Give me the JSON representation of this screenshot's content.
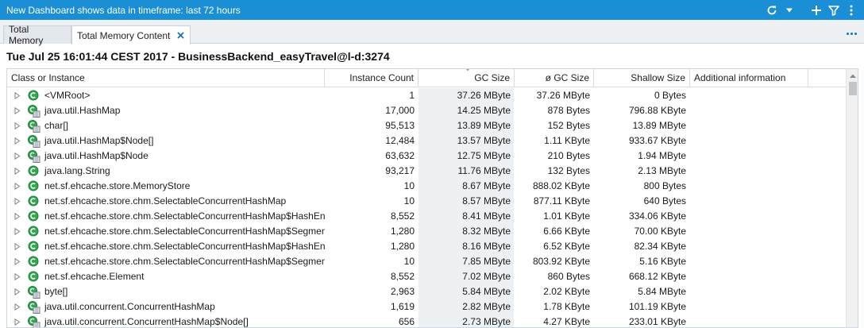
{
  "topbar": {
    "title": "New Dashboard shows data in timeframe: last 72 hours",
    "icons": [
      "refresh-icon",
      "dropdown-icon",
      "add-icon",
      "filter-icon",
      "more-vertical-icon"
    ]
  },
  "tabs": [
    {
      "label": "Total Memory"
    },
    {
      "label": "Total Memory Content"
    }
  ],
  "heading": "Tue Jul 25 16:01:44 CEST 2017 - BusinessBackend_easyTravel@l-d:3274",
  "table": {
    "columns": [
      "Class or Instance",
      "Instance Count",
      "GC Size",
      "ø GC Size",
      "Shallow Size",
      "Additional information"
    ],
    "sorted_column": "GC Size",
    "rows": [
      {
        "name": "<VMRoot>",
        "count": "1",
        "gc": "37.26 MByte",
        "avg": "37.26 MByte",
        "shallow": "0 Bytes",
        "info": "",
        "icon": "class-icon"
      },
      {
        "name": "java.util.HashMap",
        "count": "17,000",
        "gc": "14.25 MByte",
        "avg": "878 Bytes",
        "shallow": "796.88 KByte",
        "info": "",
        "icon": "class-instances-icon"
      },
      {
        "name": "char[]",
        "count": "95,513",
        "gc": "13.89 MByte",
        "avg": "152 Bytes",
        "shallow": "13.89 MByte",
        "info": "",
        "icon": "class-instances-icon"
      },
      {
        "name": "java.util.HashMap$Node[]",
        "count": "12,484",
        "gc": "13.57 MByte",
        "avg": "1.11 KByte",
        "shallow": "933.67 KByte",
        "info": "",
        "icon": "class-instances-icon"
      },
      {
        "name": "java.util.HashMap$Node",
        "count": "63,632",
        "gc": "12.75 MByte",
        "avg": "210 Bytes",
        "shallow": "1.94 MByte",
        "info": "",
        "icon": "class-instances-icon"
      },
      {
        "name": "java.lang.String",
        "count": "93,217",
        "gc": "11.76 MByte",
        "avg": "132 Bytes",
        "shallow": "2.13 MByte",
        "info": "",
        "icon": "class-icon"
      },
      {
        "name": "net.sf.ehcache.store.MemoryStore",
        "count": "10",
        "gc": "8.67 MByte",
        "avg": "888.02 KByte",
        "shallow": "800 Bytes",
        "info": "",
        "icon": "class-icon"
      },
      {
        "name": "net.sf.ehcache.store.chm.SelectableConcurrentHashMap",
        "count": "10",
        "gc": "8.57 MByte",
        "avg": "877.11 KByte",
        "shallow": "640 Bytes",
        "info": "",
        "icon": "class-icon"
      },
      {
        "name": "net.sf.ehcache.store.chm.SelectableConcurrentHashMap$HashEntry",
        "count": "8,552",
        "gc": "8.41 MByte",
        "avg": "1.01 KByte",
        "shallow": "334.06 KByte",
        "info": "",
        "icon": "class-icon"
      },
      {
        "name": "net.sf.ehcache.store.chm.SelectableConcurrentHashMap$Segment",
        "count": "1,280",
        "gc": "8.32 MByte",
        "avg": "6.66 KByte",
        "shallow": "70.00 KByte",
        "info": "",
        "icon": "class-icon"
      },
      {
        "name": "net.sf.ehcache.store.chm.SelectableConcurrentHashMap$HashEntry",
        "count": "1,280",
        "gc": "8.16 MByte",
        "avg": "6.52 KByte",
        "shallow": "82.34 KByte",
        "info": "",
        "icon": "class-icon"
      },
      {
        "name": "net.sf.ehcache.store.chm.SelectableConcurrentHashMap$Segment",
        "count": "10",
        "gc": "7.85 MByte",
        "avg": "803.92 KByte",
        "shallow": "5.16 KByte",
        "info": "",
        "icon": "class-icon"
      },
      {
        "name": "net.sf.ehcache.Element",
        "count": "8,552",
        "gc": "7.02 MByte",
        "avg": "860 Bytes",
        "shallow": "668.12 KByte",
        "info": "",
        "icon": "class-icon"
      },
      {
        "name": "byte[]",
        "count": "2,963",
        "gc": "5.84 MByte",
        "avg": "2.02 KByte",
        "shallow": "5.84 MByte",
        "info": "",
        "icon": "class-instances-icon"
      },
      {
        "name": "java.util.concurrent.ConcurrentHashMap",
        "count": "1,619",
        "gc": "2.82 MByte",
        "avg": "1.78 KByte",
        "shallow": "101.19 KByte",
        "info": "",
        "icon": "class-instances-icon"
      },
      {
        "name": "java.util.concurrent.ConcurrentHashMap$Node[]",
        "count": "656",
        "gc": "2.73 MByte",
        "avg": "4.27 KByte",
        "shallow": "233.01 KByte",
        "info": "",
        "icon": "class-instances-icon"
      }
    ]
  },
  "colors": {
    "topbar": "#1b8fd6",
    "class_icon": "#2fa84f",
    "sorted_column_bg": "#eef1f4"
  }
}
